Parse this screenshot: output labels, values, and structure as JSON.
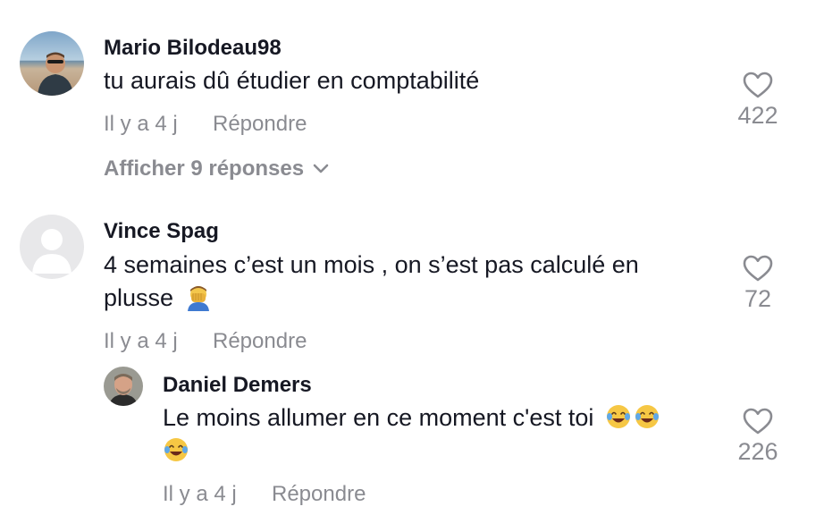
{
  "comments": [
    {
      "username": "Mario Bilodeau98",
      "text": "tu aurais dû étudier en comptabilité",
      "time": "Il y a 4 j",
      "reply_label": "Répondre",
      "likes": "422",
      "view_replies": "Afficher 9 réponses",
      "avatar": "beach-photo-avatar"
    },
    {
      "username": "Vince Spag",
      "text_line1": "4 semaines c’est un mois , on s’est pas calculé en",
      "text_line2": "plusse",
      "text_emoji": "face-palm",
      "time": "Il y a 4 j",
      "reply_label": "Répondre",
      "likes": "72",
      "avatar": "default-silhouette-avatar",
      "replies": [
        {
          "username": "Daniel Demers",
          "text": "Le moins allumer en ce moment c'est toi",
          "text_emojis": [
            "tears-of-joy",
            "tears-of-joy",
            "tears-of-joy"
          ],
          "time": "Il y a 4 j",
          "reply_label": "Répondre",
          "likes": "226",
          "avatar": "man-photo-avatar"
        }
      ]
    }
  ],
  "icons": {
    "like": "heart-outline-icon",
    "expand": "chevron-down-icon"
  },
  "colors": {
    "text": "#161823",
    "muted": "#8a8b91",
    "background": "#ffffff"
  }
}
